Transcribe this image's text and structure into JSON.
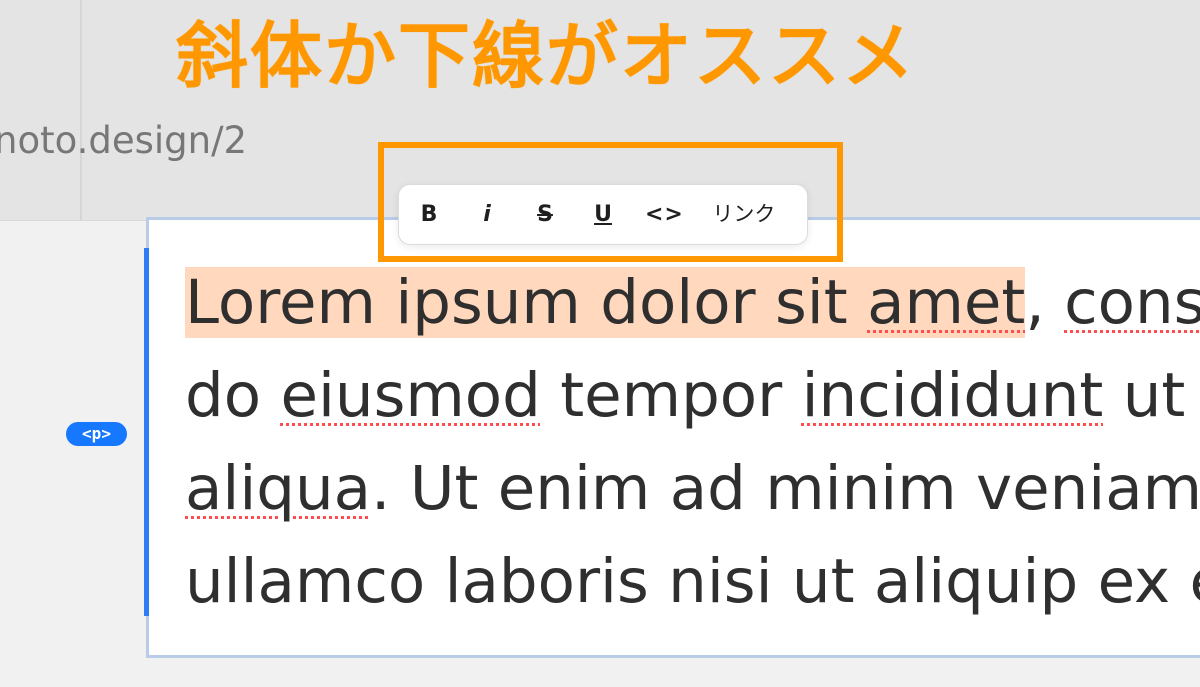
{
  "overlay": {
    "title": "斜体か下線がオススメ"
  },
  "top_area": {
    "url_text": "noto.design/2"
  },
  "toolbar": {
    "bold": "B",
    "italic": "i",
    "strikethrough": "S",
    "underline": "U",
    "code": "<>",
    "link": "リンク"
  },
  "editor": {
    "block_tag": "<p>",
    "lines": [
      {
        "selected": "Lorem ipsum dolor sit ",
        "selected_spell": "amet",
        "after_selection": ", ",
        "after_spell": "cons"
      },
      {
        "before": "do ",
        "spell_1": "eiusmod",
        "middle": " tempor ",
        "spell_2": "incididunt",
        "after": " ut"
      },
      {
        "spell": "aliqua",
        "after": ". Ut enim ad minim veniam,"
      },
      {
        "text": "ullamco laboris nisi ut aliquip ex e"
      }
    ]
  },
  "colors": {
    "accent_orange": "#ff9800",
    "selection_bg": "#ffd8bd",
    "block_badge": "#1677ff",
    "active_bar": "#2f7cf6",
    "spell_underline": "#ff4d4f"
  },
  "icons": [
    "bold-icon",
    "italic-icon",
    "strikethrough-icon",
    "underline-icon",
    "code-icon"
  ]
}
